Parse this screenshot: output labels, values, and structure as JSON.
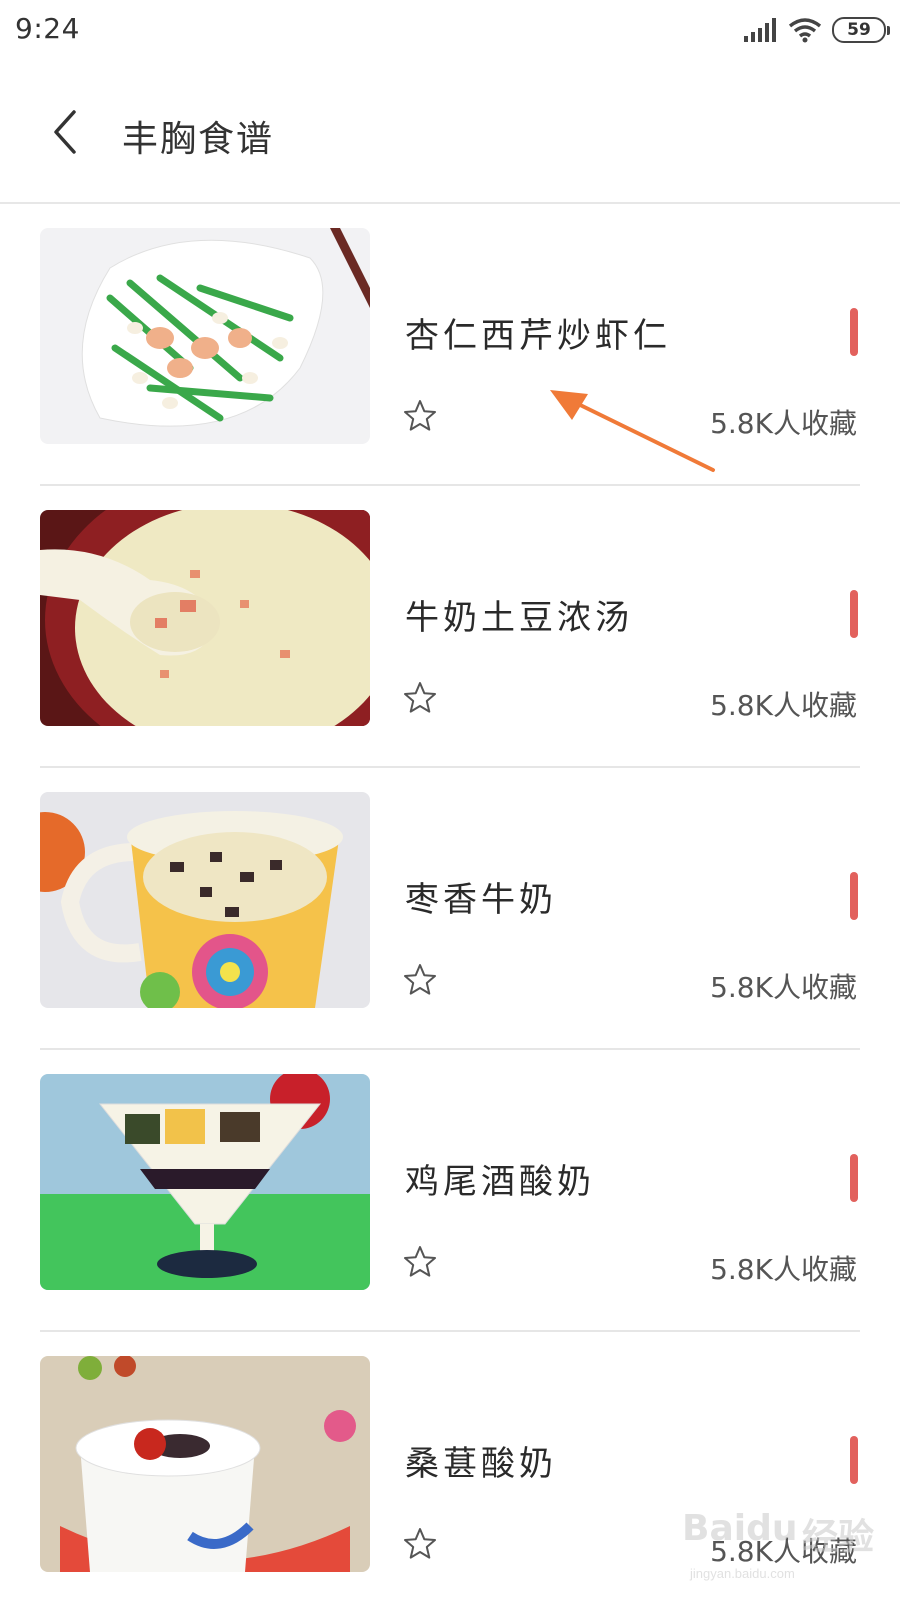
{
  "status_bar": {
    "time": "9:24",
    "battery": "59",
    "icons": [
      "signal-icon",
      "wifi-icon",
      "battery-icon"
    ]
  },
  "header": {
    "title": "丰胸食谱",
    "back_icon": "chevron-left-icon"
  },
  "recipes": [
    {
      "name": "杏仁西芹炒虾仁",
      "favorites": "5.8K人收藏"
    },
    {
      "name": "牛奶土豆浓汤",
      "favorites": "5.8K人收藏"
    },
    {
      "name": "枣香牛奶",
      "favorites": "5.8K人收藏"
    },
    {
      "name": "鸡尾酒酸奶",
      "favorites": "5.8K人收藏"
    },
    {
      "name": "桑葚酸奶",
      "favorites": "5.8K人收藏"
    }
  ],
  "watermark": {
    "brand": "Baidu",
    "cn": "经验",
    "sub": "jingyan.baidu.com"
  },
  "colors": {
    "accent": "#e2615d",
    "annotation": "#f07a38",
    "divider": "#e6e6e6"
  }
}
